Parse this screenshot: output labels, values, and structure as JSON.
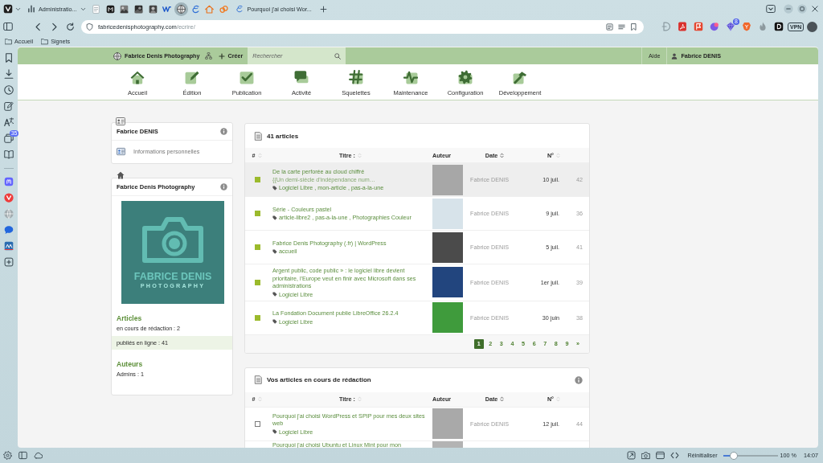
{
  "browser": {
    "tab_stack": {
      "title": "Administratio...",
      "selected": false
    },
    "pinned_tabs": [
      {
        "selected": false
      },
      {
        "selected": false
      },
      {
        "selected": false
      },
      {
        "selected": false
      },
      {
        "selected": false
      },
      {
        "selected": false
      },
      {
        "selected": true
      },
      {
        "selected": false
      },
      {
        "selected": false
      },
      {
        "selected": false
      }
    ],
    "tabs": [
      {
        "title": "Pourquoi j'ai choisi Wor...",
        "selected": false
      }
    ],
    "address": {
      "host": "fabricedenisphotography.com",
      "path": "/ecrire/"
    },
    "extension_badge": "8",
    "vpn_label": "VPN",
    "bookmarks": [
      {
        "label": "Accueil"
      },
      {
        "label": "Signets"
      }
    ],
    "panel_badge": "35",
    "status_bar": {
      "reset_label": "Réinitialiser",
      "zoom": {
        "level": 0.2
      },
      "zoom_reading": "100 %",
      "clock": "14:07"
    }
  },
  "admin_bar": {
    "site": "Fabrice Denis Photography",
    "create": "Créer",
    "search": {
      "placeholder": "Rechercher"
    },
    "help": "Aide",
    "user": "Fabrice DENIS"
  },
  "toolbar": [
    {
      "label": "Accueil"
    },
    {
      "label": "Édition"
    },
    {
      "label": "Publication"
    },
    {
      "label": "Activité"
    },
    {
      "label": "Squelettes"
    },
    {
      "label": "Maintenance"
    },
    {
      "label": "Configuration"
    },
    {
      "label": "Développement"
    }
  ],
  "sidebar": {
    "profile_card": {
      "title": "Fabrice DENIS",
      "info": true,
      "link": "Informations personnelles"
    },
    "site_card": {
      "title": "Fabrice Denis Photography",
      "info": true,
      "logo": {
        "name": "FABRICE DENIS",
        "tagline": "PHOTOGRAPHY"
      },
      "sections": [
        {
          "heading": "Articles",
          "items": [
            {
              "label": "en cours de rédaction : 2",
              "selected": false
            },
            {
              "label": "publiés en ligne : 41",
              "selected": true
            }
          ]
        },
        {
          "heading": "Auteurs",
          "items": [
            {
              "label": "Admins : 1",
              "selected": false
            }
          ]
        }
      ]
    }
  },
  "lists": [
    {
      "title": "41 articles",
      "info": false,
      "columns": [
        {
          "label": "#",
          "sortable": true,
          "sorted": false
        },
        {
          "label": "Titre :",
          "sortable": true,
          "sorted": false
        },
        {
          "label": "Auteur",
          "sortable": false,
          "sorted": false
        },
        {
          "label": "Date",
          "sortable": true,
          "sorted": true
        },
        {
          "label": "N°",
          "sortable": true,
          "sorted": false
        }
      ],
      "rows": [
        {
          "published": true,
          "hovered": true,
          "title": "De la carte perforée au cloud chiffré",
          "subtitle": "{{Un demi-siècle d'indépendance num…",
          "tags": "Logiciel Libre , mon-article , pas-a-la-une",
          "author": "Fabrice DENIS",
          "date": "10 juil.",
          "number": "42"
        },
        {
          "published": true,
          "hovered": false,
          "title": "Série - Couleurs pastel",
          "tags": "article-libre2 , pas-a-la-une , Photographies Couleur",
          "author": "Fabrice DENIS",
          "date": "9 juil.",
          "number": "36"
        },
        {
          "published": true,
          "hovered": false,
          "title": "Fabrice Denis Photography (.fr) | WordPress",
          "tags": "accueil",
          "author": "Fabrice DENIS",
          "date": "5 juil.",
          "number": "41"
        },
        {
          "published": true,
          "hovered": false,
          "title": "Argent public, code public » : le logiciel libre devient prioritaire, l'Europe veut en finir avec Microsoft dans ses administrations",
          "tags": "Logiciel Libre",
          "author": "Fabrice DENIS",
          "date": "1er juil.",
          "number": "39"
        },
        {
          "published": true,
          "hovered": false,
          "title": "La Fondation Document publie LibreOffice 26.2.4",
          "tags": "Logiciel Libre",
          "author": "Fabrice DENIS",
          "date": "30 juin",
          "number": "38"
        }
      ],
      "pagination": [
        {
          "label": "1",
          "selected": true
        },
        {
          "label": "2",
          "selected": false
        },
        {
          "label": "3",
          "selected": false
        },
        {
          "label": "4",
          "selected": false
        },
        {
          "label": "5",
          "selected": false
        },
        {
          "label": "6",
          "selected": false
        },
        {
          "label": "7",
          "selected": false
        },
        {
          "label": "8",
          "selected": false
        },
        {
          "label": "9",
          "selected": false
        },
        {
          "label": "»",
          "selected": false
        }
      ]
    },
    {
      "title": "Vos articles en cours de rédaction",
      "info": true,
      "columns": [
        {
          "label": "#",
          "sortable": true,
          "sorted": false
        },
        {
          "label": "Titre :",
          "sortable": true,
          "sorted": false
        },
        {
          "label": "Auteur",
          "sortable": false,
          "sorted": false
        },
        {
          "label": "Date",
          "sortable": true,
          "sorted": true
        },
        {
          "label": "N°",
          "sortable": true,
          "sorted": false
        }
      ],
      "rows": [
        {
          "published": false,
          "hovered": false,
          "title": "Pourquoi j'ai choisi WordPress et SPIP pour mes deux sites web",
          "tags": "Logiciel Libre",
          "author": "Fabrice DENIS",
          "date": "12 juil.",
          "number": "44"
        },
        {
          "hovered": false,
          "title": "Pourquoi j'ai choisi Ubuntu et Linux Mint pour mon"
        }
      ]
    }
  ]
}
